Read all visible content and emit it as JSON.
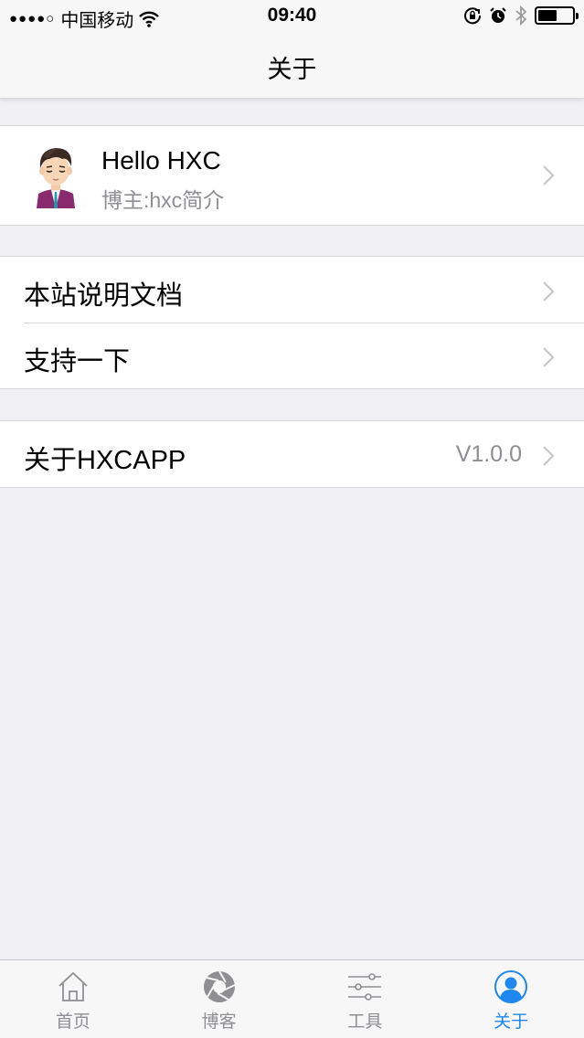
{
  "status_bar": {
    "signal": "●●●●○",
    "carrier": "中国移动",
    "time": "09:40",
    "battery_level": 0.55
  },
  "nav": {
    "title": "关于"
  },
  "profile": {
    "name": "Hello HXC",
    "subtitle": "博主:hxc简介"
  },
  "menu": {
    "docs_label": "本站说明文档",
    "support_label": "支持一下",
    "about_label": "关于HXCAPP",
    "version": "V1.0.0"
  },
  "tabs": [
    {
      "label": "首页",
      "icon": "home-icon"
    },
    {
      "label": "博客",
      "icon": "aperture-icon"
    },
    {
      "label": "工具",
      "icon": "sliders-icon"
    },
    {
      "label": "关于",
      "icon": "user-icon"
    }
  ],
  "colors": {
    "accent": "#1e87f0",
    "inactive": "#8e8e93",
    "background": "#efeff4"
  }
}
